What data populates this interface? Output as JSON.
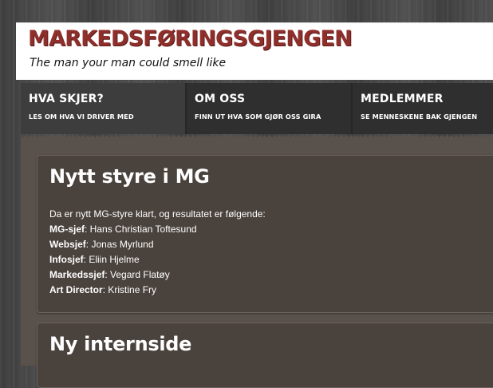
{
  "header": {
    "site_title": "MARKEDSFØRINGSGJENGEN",
    "tagline": "The man your man could smell like"
  },
  "nav": {
    "items": [
      {
        "title": "HVA SKJER?",
        "subtitle": "LES OM HVA VI DRIVER MED"
      },
      {
        "title": "OM OSS",
        "subtitle": "FINN UT HVA SOM GJØR OSS GIRA"
      },
      {
        "title": "MEDLEMMER",
        "subtitle": "SE MENNESKENE BAK GJENGEN"
      }
    ]
  },
  "posts": [
    {
      "title": "Nytt styre i MG",
      "intro": "Da er nytt MG-styre klart, og resultatet er følgende:",
      "roles": [
        {
          "role": "MG-sjef",
          "name": ": Hans Christian Toftesund"
        },
        {
          "role": "Websjef",
          "name": ": Jonas Myrlund"
        },
        {
          "role": "Infosjef",
          "name": ": Eliin Hjelme"
        },
        {
          "role": "Markedssjef",
          "name": ": Vegard Flatøy"
        },
        {
          "role": "Art Director",
          "name": ": Kristine Fry"
        }
      ]
    },
    {
      "title": "Ny internside"
    }
  ],
  "colors": {
    "brand": "#8f2f2c",
    "nav_bg": "#2f2f2f",
    "nav_active_bg": "#3d3d3d",
    "content_bg": "#59514b",
    "post_bg": "#4a423d"
  }
}
